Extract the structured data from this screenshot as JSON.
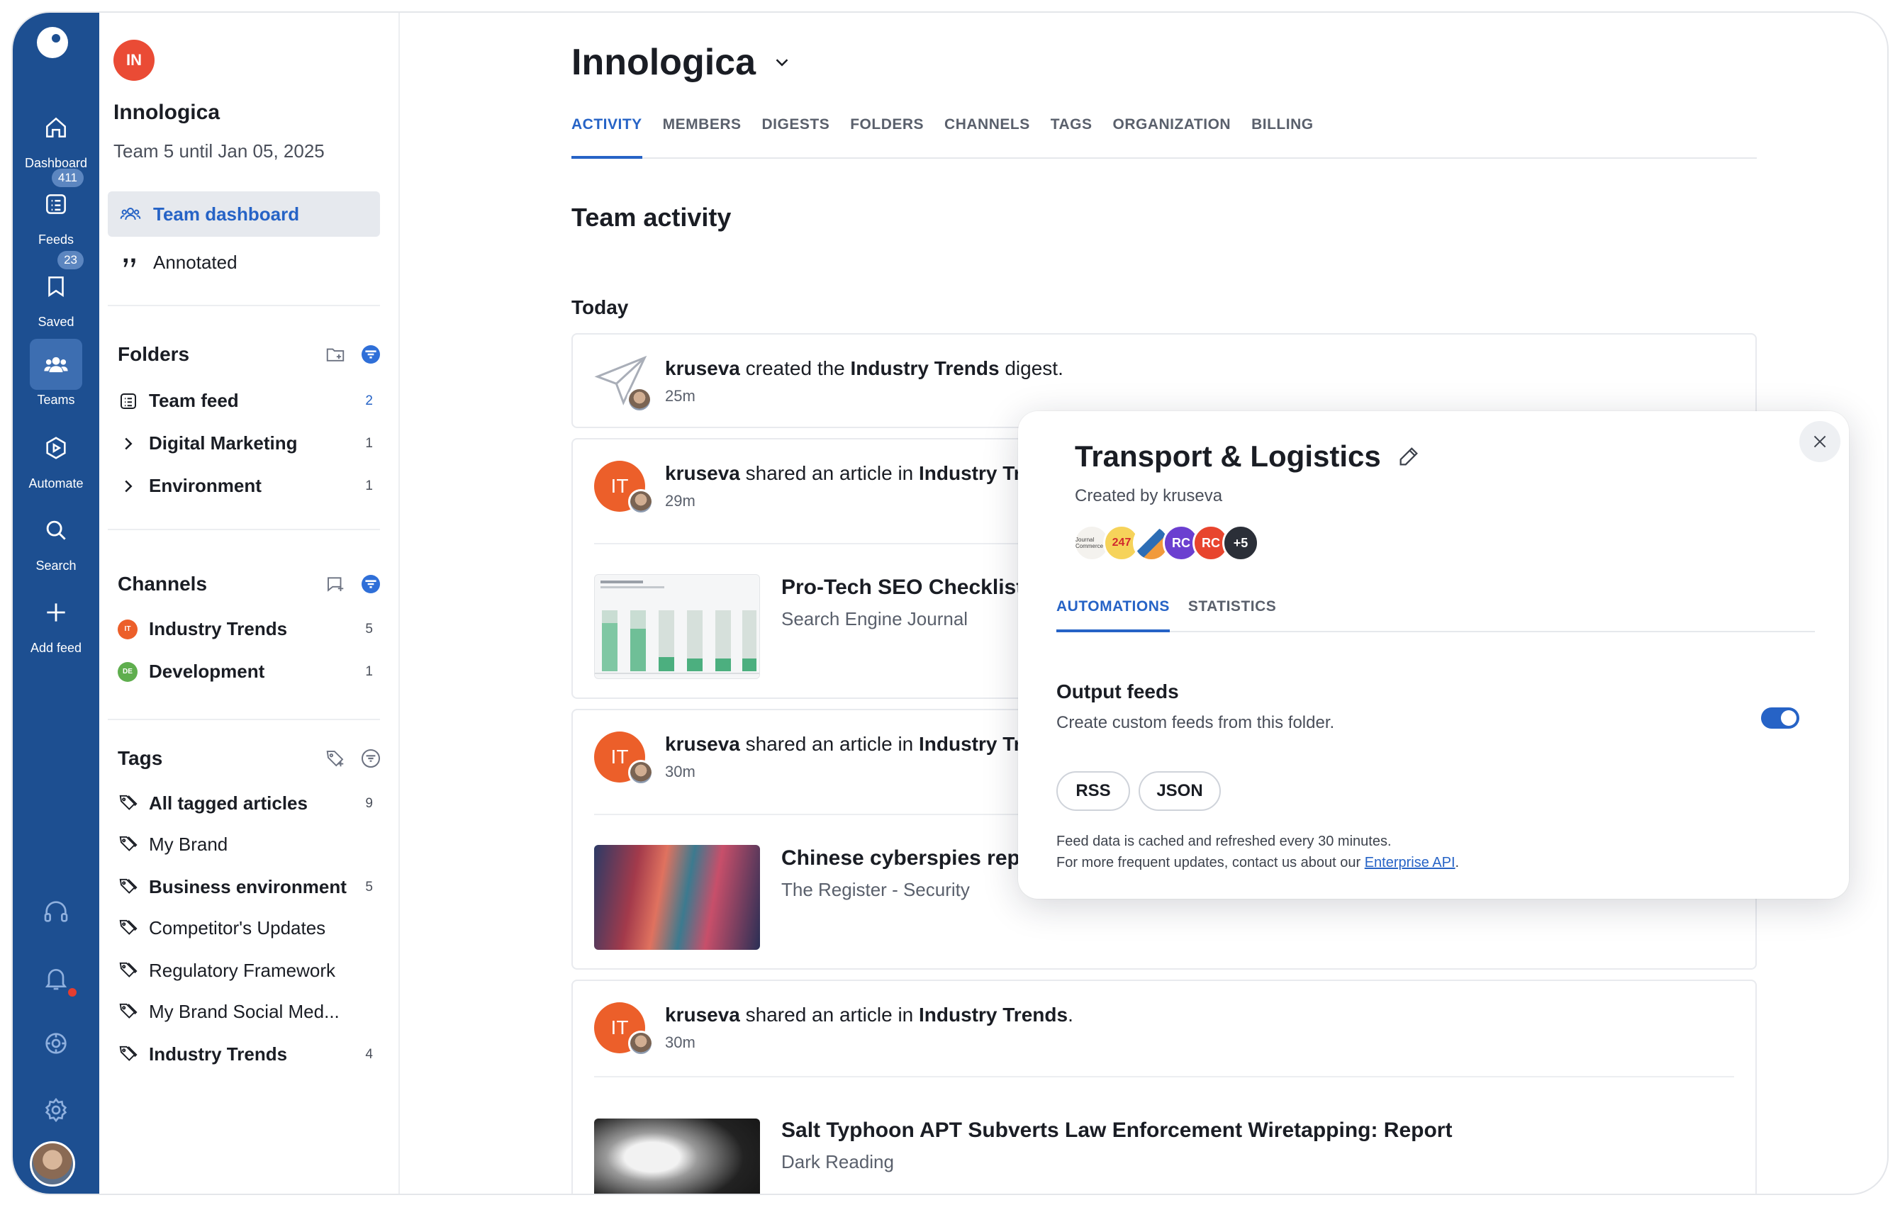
{
  "rail": {
    "items": [
      {
        "label": "Dashboard",
        "icon": "home-icon"
      },
      {
        "label": "Feeds",
        "icon": "feeds-icon",
        "badge": "411"
      },
      {
        "label": "Saved",
        "icon": "bookmark-icon",
        "badge": "23"
      },
      {
        "label": "Teams",
        "icon": "teams-icon"
      },
      {
        "label": "Automate",
        "icon": "automate-icon"
      },
      {
        "label": "Search",
        "icon": "search-icon"
      },
      {
        "label": "Add feed",
        "icon": "plus-icon"
      }
    ]
  },
  "sidebar": {
    "team_initials": "IN",
    "team_name": "Innologica",
    "team_plan": "Team 5 until Jan 05, 2025",
    "nav": [
      {
        "label": "Team dashboard",
        "active": true
      },
      {
        "label": "Annotated",
        "active": false
      }
    ],
    "folders": {
      "title": "Folders",
      "items": [
        {
          "label": "Team feed",
          "count": "2"
        },
        {
          "label": "Digital Marketing",
          "count": "1"
        },
        {
          "label": "Environment",
          "count": "1"
        }
      ]
    },
    "channels": {
      "title": "Channels",
      "items": [
        {
          "label": "Industry Trends",
          "count": "5",
          "chip": "IT",
          "color": "#ec5f2a"
        },
        {
          "label": "Development",
          "count": "1",
          "chip": "DE",
          "color": "#5fae4e"
        }
      ]
    },
    "tags": {
      "title": "Tags",
      "items": [
        {
          "label": "All tagged articles",
          "count": "9"
        },
        {
          "label": "My Brand",
          "count": ""
        },
        {
          "label": "Business environment",
          "count": "5"
        },
        {
          "label": "Competitor's Updates",
          "count": ""
        },
        {
          "label": "Regulatory Framework",
          "count": ""
        },
        {
          "label": "My Brand Social Med...",
          "count": ""
        },
        {
          "label": "Industry Trends",
          "count": "4"
        }
      ]
    }
  },
  "main": {
    "title": "Innologica",
    "tabs": [
      "ACTIVITY",
      "MEMBERS",
      "DIGESTS",
      "FOLDERS",
      "CHANNELS",
      "TAGS",
      "ORGANIZATION",
      "BILLING"
    ],
    "section_title": "Team activity",
    "day_label": "Today",
    "activities": [
      {
        "user": "kruseva",
        "verb": " created the ",
        "target": "Industry Trends",
        "suffix": " digest.",
        "time": "25m"
      },
      {
        "user": "kruseva",
        "verb": " shared an article in ",
        "target": "Industry Tr",
        "suffix": "",
        "time": "29m",
        "article_title": "Pro-Tech SEO Checklist I",
        "article_source": "Search Engine Journal"
      },
      {
        "user": "kruseva",
        "verb": " shared an article in ",
        "target": "Industry Tr",
        "suffix": "",
        "time": "30m",
        "article_title": "Chinese cyberspies repo",
        "article_source": "The Register - Security"
      },
      {
        "user": "kruseva",
        "verb": " shared an article in ",
        "target": "Industry Trends",
        "suffix": ".",
        "time": "30m",
        "article_title": "Salt Typhoon APT Subverts Law Enforcement Wiretapping: Report",
        "article_source": "Dark Reading"
      }
    ],
    "avatar_initials": "IT"
  },
  "popover": {
    "title": "Transport & Logistics",
    "created_by": "Created by kruseva",
    "sources": [
      "Journal Commerce",
      "247",
      "",
      "RC",
      "RC",
      "+5"
    ],
    "tabs": [
      "AUTOMATIONS",
      "STATISTICS"
    ],
    "output_title": "Output feeds",
    "output_sub": "Create custom feeds from this folder.",
    "toggle_on": true,
    "formats": [
      "RSS",
      "JSON"
    ],
    "note_line1": "Feed data is cached and refreshed every 30 minutes.",
    "note_line2_prefix": "For more frequent updates, contact us about our ",
    "note_link": "Enterprise API",
    "note_line2_suffix": "."
  },
  "colors": {
    "rail": "#1d4f91",
    "accent": "#2663c6",
    "team_avatar": "#ea4b35",
    "channel_avatar": "#ec5f2a"
  }
}
